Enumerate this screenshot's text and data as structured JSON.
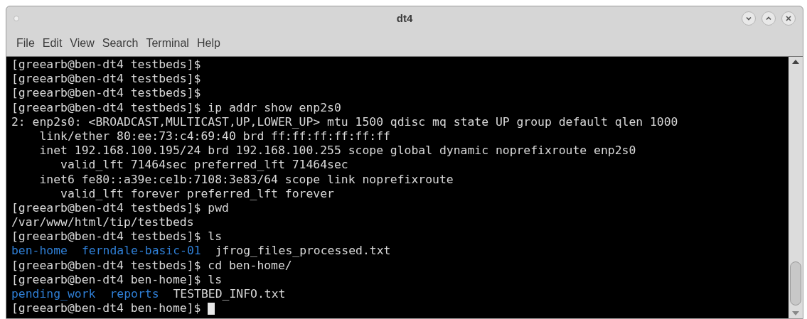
{
  "window": {
    "title": "dt4"
  },
  "menu": [
    "File",
    "Edit",
    "View",
    "Search",
    "Terminal",
    "Help"
  ],
  "terminal": {
    "lines": [
      {
        "kind": "text",
        "text": "[greearb@ben-dt4 testbeds]$"
      },
      {
        "kind": "text",
        "text": "[greearb@ben-dt4 testbeds]$"
      },
      {
        "kind": "text",
        "text": "[greearb@ben-dt4 testbeds]$"
      },
      {
        "kind": "text",
        "text": "[greearb@ben-dt4 testbeds]$ ip addr show enp2s0"
      },
      {
        "kind": "text",
        "text": "2: enp2s0: <BROADCAST,MULTICAST,UP,LOWER_UP> mtu 1500 qdisc mq state UP group default qlen 1000"
      },
      {
        "kind": "text",
        "text": "    link/ether 80:ee:73:c4:69:40 brd ff:ff:ff:ff:ff:ff"
      },
      {
        "kind": "text",
        "text": "    inet 192.168.100.195/24 brd 192.168.100.255 scope global dynamic noprefixroute enp2s0"
      },
      {
        "kind": "text",
        "text": "       valid_lft 71464sec preferred_lft 71464sec"
      },
      {
        "kind": "text",
        "text": "    inet6 fe80::a39e:ce1b:7108:3e83/64 scope link noprefixroute"
      },
      {
        "kind": "text",
        "text": "       valid_lft forever preferred_lft forever"
      },
      {
        "kind": "text",
        "text": "[greearb@ben-dt4 testbeds]$ pwd"
      },
      {
        "kind": "text",
        "text": "/var/www/html/tip/testbeds"
      },
      {
        "kind": "text",
        "text": "[greearb@ben-dt4 testbeds]$ ls"
      },
      {
        "kind": "listing",
        "entries": [
          {
            "name": "ben-home",
            "kind": "directory"
          },
          {
            "name": "ferndale-basic-01",
            "kind": "directory"
          },
          {
            "name": "jfrog_files_processed.txt",
            "kind": "file"
          }
        ]
      },
      {
        "kind": "text",
        "text": "[greearb@ben-dt4 testbeds]$ cd ben-home/"
      },
      {
        "kind": "text",
        "text": "[greearb@ben-dt4 ben-home]$ ls"
      },
      {
        "kind": "listing",
        "entries": [
          {
            "name": "pending_work",
            "kind": "directory"
          },
          {
            "name": "reports",
            "kind": "directory"
          },
          {
            "name": "TESTBED_INFO.txt",
            "kind": "file"
          }
        ]
      },
      {
        "kind": "prompt",
        "text": "[greearb@ben-dt4 ben-home]$",
        "cursor": true
      }
    ]
  }
}
